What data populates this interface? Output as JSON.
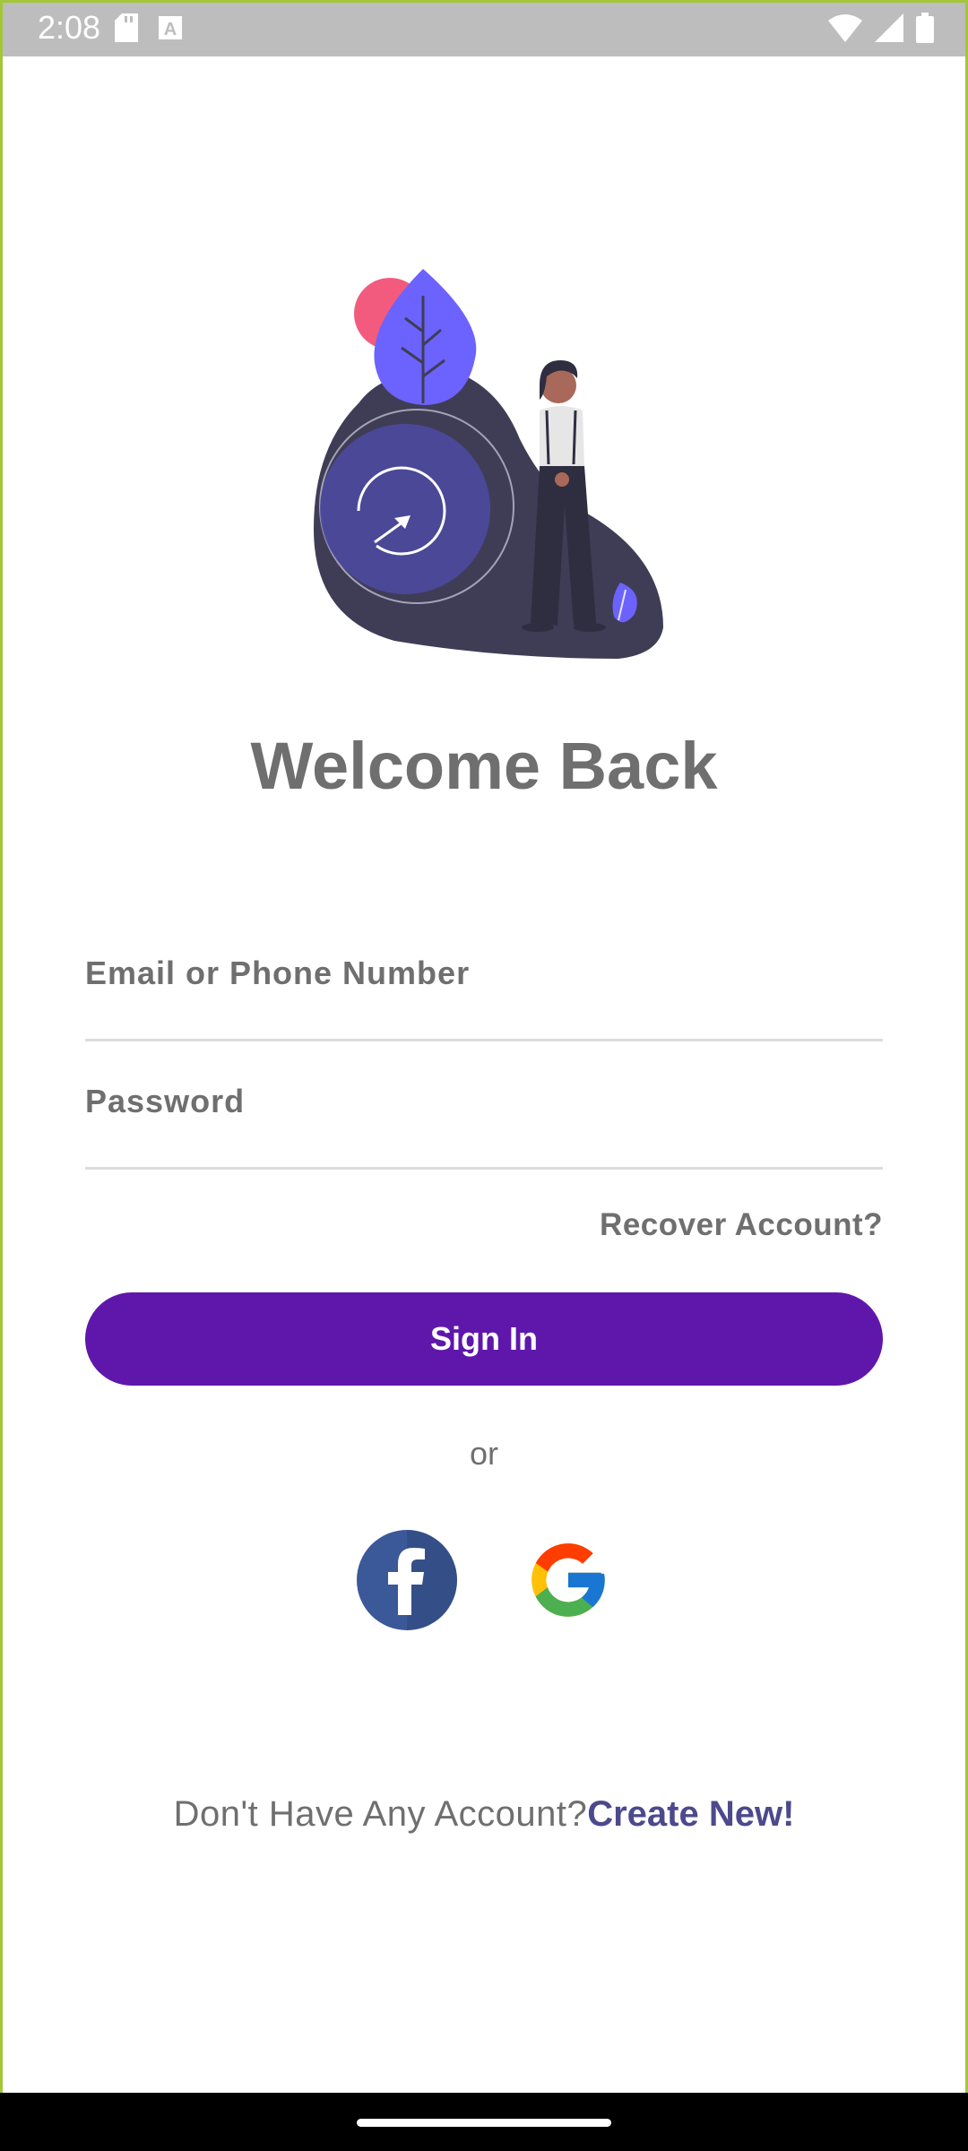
{
  "status_bar": {
    "time": "2:08",
    "icons_left": [
      "sd-card-icon",
      "text-a-icon"
    ],
    "icons_right": [
      "wifi-icon",
      "cell-signal-icon",
      "battery-icon"
    ]
  },
  "illustration": {
    "name": "welcome-illustration"
  },
  "title": "Welcome Back",
  "email_field": {
    "placeholder": "Email or Phone Number",
    "value": ""
  },
  "password_field": {
    "placeholder": "Password",
    "value": ""
  },
  "recover_label": "Recover Account?",
  "signin_label": "Sign In",
  "or_label": "or",
  "social": {
    "facebook": "facebook-icon",
    "google": "google-icon"
  },
  "footer": {
    "question": "Don't Have Any Account?",
    "link": "Create New!"
  },
  "colors": {
    "primary": "#5f17ab",
    "link": "#4c4a8c",
    "text": "#6f6f6f",
    "frame": "#a4c639"
  }
}
